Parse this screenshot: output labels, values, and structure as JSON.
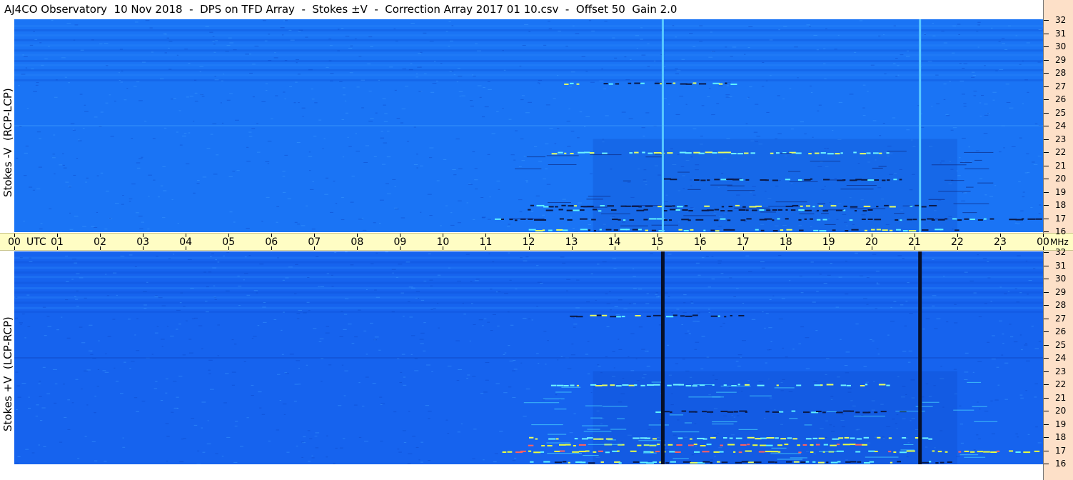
{
  "title": "AJ4CO Observatory  10 Nov 2018  -  DPS on TFD Array  -  Stokes ±V  -  Correction Array 2017 01 10.csv  -  Offset 50  Gain 2.0",
  "colors": {
    "panel_top_base": "#1a74f5",
    "panel_bottom_base": "#1663ee",
    "axis_band": "#fffdc4",
    "freq_axis_bg": "#fde0c8",
    "dark_line": "#0a1a4a",
    "bright_line": "#4ff0ff",
    "hot_line": "#e8ff40"
  },
  "chart_data": [
    {
      "type": "heatmap",
      "panel": "top",
      "ylabel": "Stokes -V  (RCP-LCP)",
      "x_unit": "UTC",
      "xlim": [
        0,
        24
      ],
      "x_tick_labels": [
        "00",
        "01",
        "02",
        "03",
        "04",
        "05",
        "06",
        "07",
        "08",
        "09",
        "10",
        "11",
        "12",
        "13",
        "14",
        "15",
        "16",
        "17",
        "18",
        "19",
        "20",
        "21",
        "22",
        "23",
        "00"
      ],
      "y_unit": "MHz",
      "ylim": [
        16,
        32
      ],
      "y_tick_labels": [
        "32",
        "31",
        "30",
        "29",
        "28",
        "27",
        "26",
        "25",
        "24",
        "23",
        "22",
        "21",
        "20",
        "19",
        "18",
        "17",
        "16"
      ],
      "vertical_interference_hours": [
        15.13,
        21.13
      ],
      "vertical_interference_style": "bright",
      "bursts": [
        {
          "freq": 27.2,
          "start": 12.8,
          "end": 17.0,
          "kind": "mixed"
        },
        {
          "freq": 22.0,
          "start": 12.5,
          "end": 20.5,
          "kind": "bright"
        },
        {
          "freq": 20.0,
          "start": 14.8,
          "end": 20.8,
          "kind": "dark"
        },
        {
          "freq": 18.0,
          "start": 12.0,
          "end": 21.5,
          "kind": "mixed"
        },
        {
          "freq": 17.7,
          "start": 11.8,
          "end": 20.0,
          "kind": "dark"
        },
        {
          "freq": 17.0,
          "start": 11.2,
          "end": 24.0,
          "kind": "dark"
        },
        {
          "freq": 16.2,
          "start": 12.0,
          "end": 22.0,
          "kind": "mixed"
        }
      ]
    },
    {
      "type": "heatmap",
      "panel": "bottom",
      "ylabel": "Stokes +V  (LCP-RCP)",
      "x_unit": "UTC",
      "xlim": [
        0,
        24
      ],
      "y_unit": "MHz",
      "ylim": [
        16,
        32
      ],
      "y_tick_labels": [
        "32",
        "31",
        "30",
        "29",
        "28",
        "27",
        "26",
        "25",
        "24",
        "23",
        "22",
        "21",
        "20",
        "19",
        "18",
        "17",
        "16"
      ],
      "vertical_interference_hours": [
        15.13,
        21.13
      ],
      "vertical_interference_style": "dark",
      "bursts": [
        {
          "freq": 27.2,
          "start": 12.8,
          "end": 17.0,
          "kind": "mixed"
        },
        {
          "freq": 22.0,
          "start": 12.5,
          "end": 20.5,
          "kind": "bright"
        },
        {
          "freq": 20.0,
          "start": 14.8,
          "end": 20.8,
          "kind": "dark"
        },
        {
          "freq": 18.0,
          "start": 12.0,
          "end": 21.5,
          "kind": "bright"
        },
        {
          "freq": 17.5,
          "start": 11.8,
          "end": 20.0,
          "kind": "hot"
        },
        {
          "freq": 17.0,
          "start": 11.2,
          "end": 24.0,
          "kind": "hot"
        },
        {
          "freq": 16.2,
          "start": 12.0,
          "end": 22.0,
          "kind": "mixed"
        }
      ]
    }
  ],
  "time_axis": {
    "utc_label": "UTC",
    "mhz_label": "MHz"
  }
}
